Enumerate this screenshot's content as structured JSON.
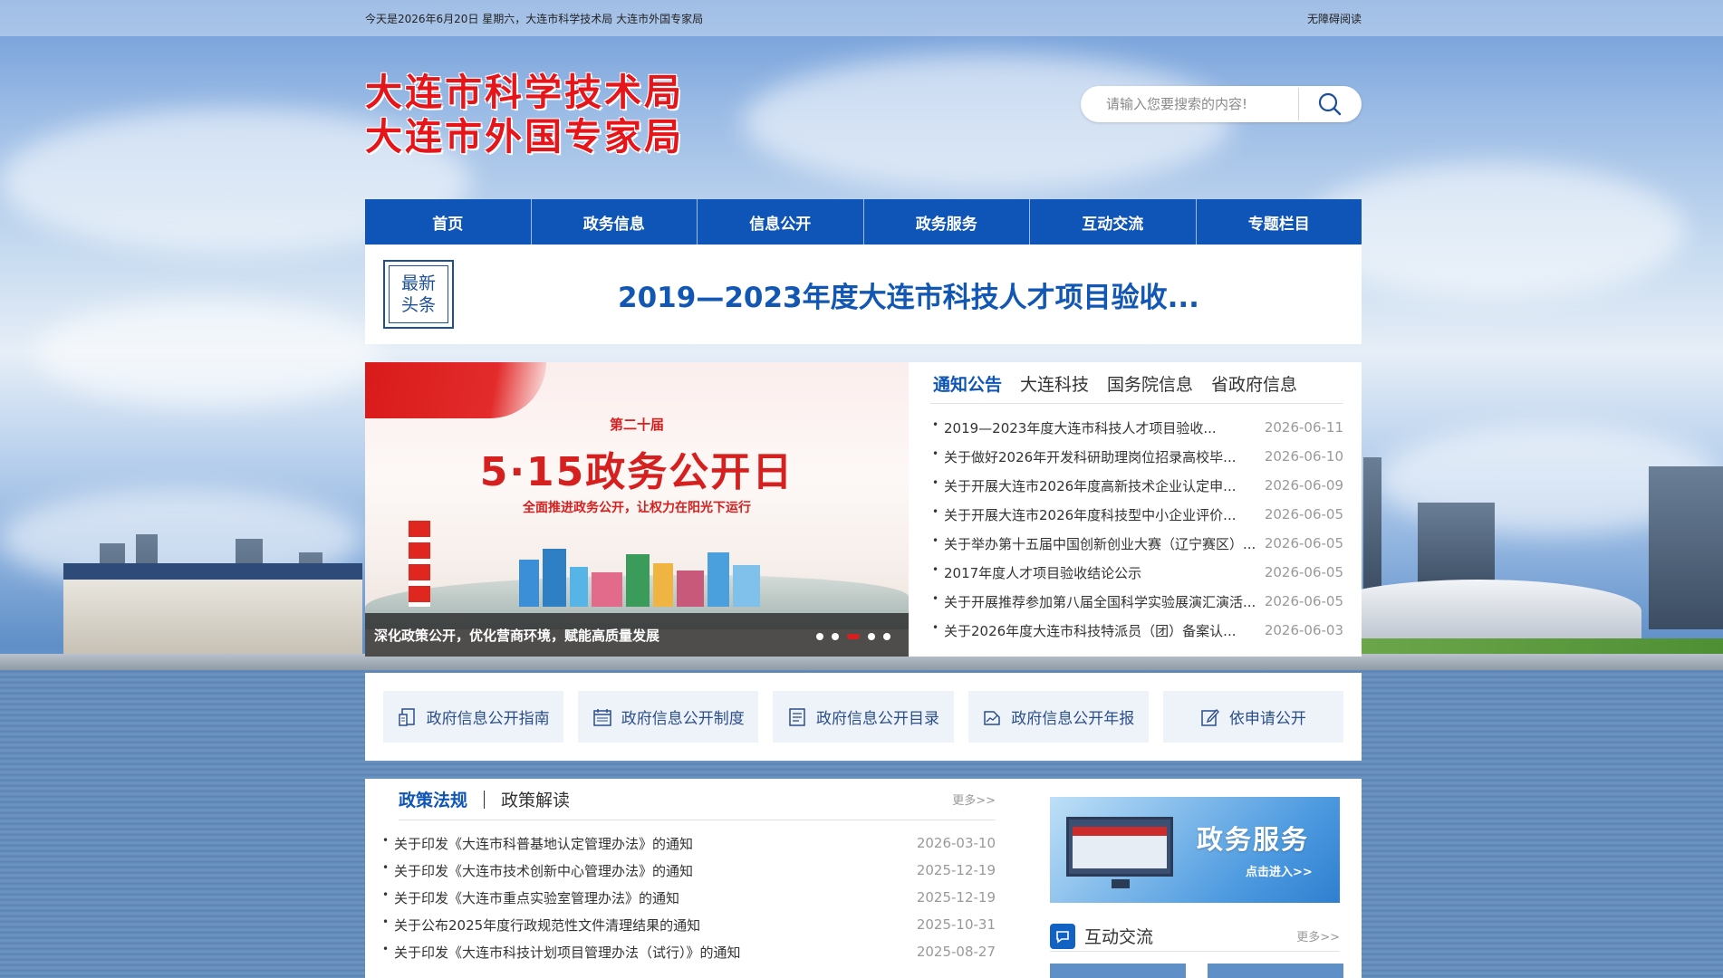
{
  "topbar": {
    "date_text": "今天是2026年6月20日 星期六，大连市科学技术局 大连市外国专家局",
    "accessible_link": "无障碍阅读"
  },
  "logo": {
    "line1": "大连市科学技术局",
    "line2": "大连市外国专家局"
  },
  "search": {
    "placeholder": "请输入您要搜索的内容!",
    "icon": "search-icon"
  },
  "nav": {
    "items": [
      {
        "label": "首页"
      },
      {
        "label": "政务信息"
      },
      {
        "label": "信息公开"
      },
      {
        "label": "政务服务"
      },
      {
        "label": "互动交流"
      },
      {
        "label": "专题栏目"
      }
    ]
  },
  "headline": {
    "badge_line1": "最新",
    "badge_line2": "头条",
    "title": "2019—2023年度大连市科技人才项目验收..."
  },
  "banner": {
    "kicker": "第二十届",
    "title": "5·15政务公开日",
    "subtitle": "全面推进政务公开，让权力在阳光下运行",
    "caption": "深化政策公开，优化营商环境，赋能高质量发展",
    "active_slide": 3,
    "slide_count": 5
  },
  "news": {
    "tabs": [
      {
        "label": "通知公告",
        "active": true
      },
      {
        "label": "大连科技",
        "active": false
      },
      {
        "label": "国务院信息",
        "active": false
      },
      {
        "label": "省政府信息",
        "active": false
      }
    ],
    "items": [
      {
        "title": "2019—2023年度大连市科技人才项目验收...",
        "date": "2026-06-11"
      },
      {
        "title": "关于做好2026年开发科研助理岗位招录高校毕...",
        "date": "2026-06-10"
      },
      {
        "title": "关于开展大连市2026年度高新技术企业认定申...",
        "date": "2026-06-09"
      },
      {
        "title": "关于开展大连市2026年度科技型中小企业评价...",
        "date": "2026-06-05"
      },
      {
        "title": "关于举办第十五届中国创新创业大赛（辽宁赛区）...",
        "date": "2026-06-05"
      },
      {
        "title": "2017年度人才项目验收结论公示",
        "date": "2026-06-05"
      },
      {
        "title": "关于开展推荐参加第八届全国科学实验展演汇演活...",
        "date": "2026-06-05"
      },
      {
        "title": "关于2026年度大连市科技特派员（团）备案认...",
        "date": "2026-06-03"
      }
    ]
  },
  "quick_links": [
    {
      "label": "政府信息公开指南",
      "icon": "document-guide-icon"
    },
    {
      "label": "政府信息公开制度",
      "icon": "calendar-rules-icon"
    },
    {
      "label": "政府信息公开目录",
      "icon": "list-catalog-icon"
    },
    {
      "label": "政府信息公开年报",
      "icon": "report-chart-icon"
    },
    {
      "label": "依申请公开",
      "icon": "edit-apply-icon"
    }
  ],
  "policy": {
    "tabs": [
      {
        "label": "政策法规",
        "active": true
      },
      {
        "label": "政策解读",
        "active": false
      }
    ],
    "more": "更多>>",
    "items": [
      {
        "title": "关于印发《大连市科普基地认定管理办法》的通知",
        "date": "2026-03-10"
      },
      {
        "title": "关于印发《大连市技术创新中心管理办法》的通知",
        "date": "2025-12-19"
      },
      {
        "title": "关于印发《大连市重点实验室管理办法》的通知",
        "date": "2025-12-19"
      },
      {
        "title": "关于公布2025年度行政规范性文件清理结果的通知",
        "date": "2025-10-31"
      },
      {
        "title": "关于印发《大连市科技计划项目管理办法（试行）》的通知",
        "date": "2025-08-27"
      }
    ]
  },
  "side": {
    "gov_service_title": "政务服务",
    "gov_service_enter": "点击进入>>",
    "interact_title": "互动交流",
    "interact_more": "更多>>"
  },
  "colors": {
    "brand_blue": "#0f55b7",
    "logo_red": "#e5151a",
    "banner_red": "#d5201f"
  }
}
